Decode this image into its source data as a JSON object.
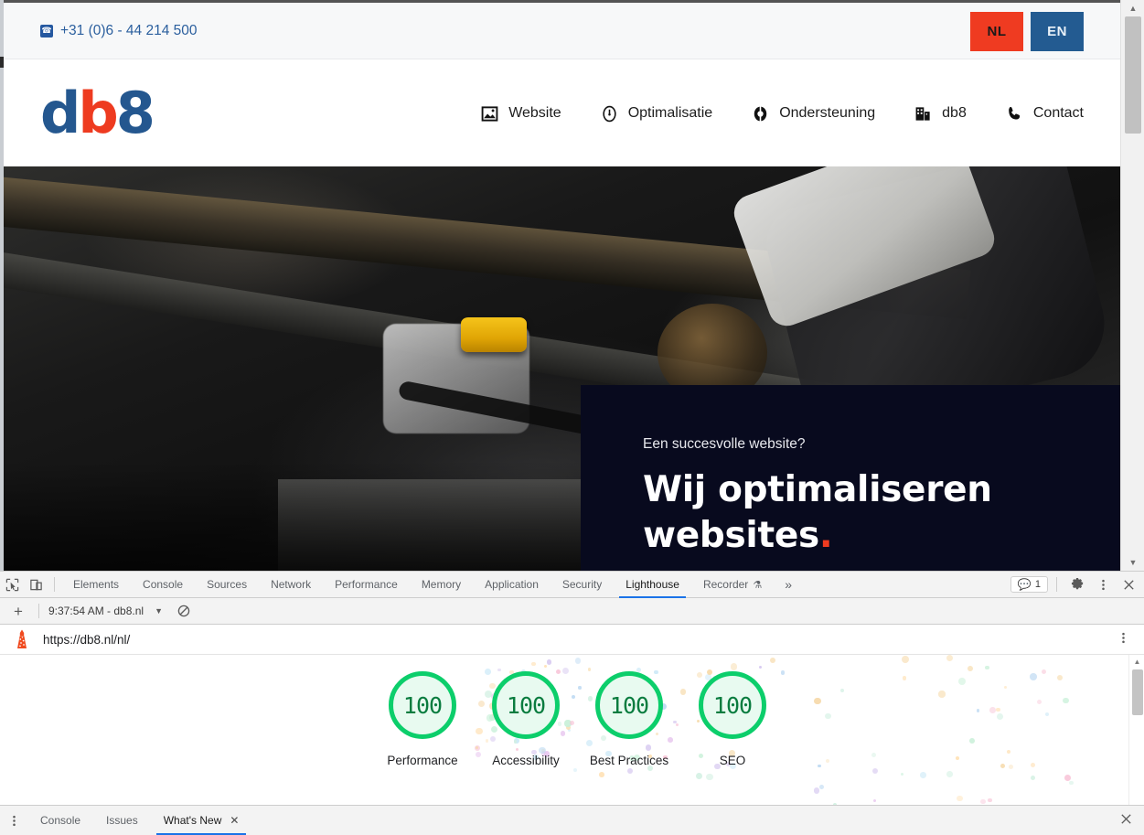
{
  "website": {
    "topbar": {
      "phone": "+31 (0)6 - 44 214 500",
      "phone_icon": "phone-icon",
      "lang_nl": "NL",
      "lang_en": "EN",
      "nl_color": "#ef3b21",
      "en_color": "#235b91"
    },
    "logo": {
      "part1": "d",
      "part2": "b",
      "part3": "8",
      "blue": "#24578f",
      "red": "#ee3b20"
    },
    "nav": [
      {
        "label": "Website",
        "icon": "image-icon"
      },
      {
        "label": "Optimalisatie",
        "icon": "gauge-icon"
      },
      {
        "label": "Ondersteuning",
        "icon": "lifebuoy-icon"
      },
      {
        "label": "db8",
        "icon": "building-icon"
      },
      {
        "label": "Contact",
        "icon": "phone-handset-icon"
      }
    ],
    "hero": {
      "eyebrow": "Een succesvolle website?",
      "title_line1": "Wij optimaliseren",
      "title_line2": "websites",
      "title_dot": ".",
      "panel_color": "#080a1e",
      "accent": "#ee3b20"
    }
  },
  "devtools": {
    "inspect_icon": "inspect-cursor-icon",
    "device_icon": "device-toolbar-icon",
    "tabs": [
      {
        "label": "Elements",
        "active": false
      },
      {
        "label": "Console",
        "active": false
      },
      {
        "label": "Sources",
        "active": false
      },
      {
        "label": "Network",
        "active": false
      },
      {
        "label": "Performance",
        "active": false
      },
      {
        "label": "Memory",
        "active": false
      },
      {
        "label": "Application",
        "active": false
      },
      {
        "label": "Security",
        "active": false
      },
      {
        "label": "Lighthouse",
        "active": true
      },
      {
        "label": "Recorder",
        "active": false,
        "suffix_icon": "flask-icon"
      }
    ],
    "more_tabs": "»",
    "messages_badge": {
      "icon": "message-icon",
      "count": "1"
    },
    "settings_icon": "gear-icon",
    "kebab_icon": "more-vertical-icon",
    "close_icon": "close-icon",
    "active_tab_underline": "#1a73e8"
  },
  "lighthouse": {
    "toolbar": {
      "new_report_icon": "plus-icon",
      "report_name": "9:37:54 AM - db8.nl",
      "dropdown_icon": "chevron-down-icon",
      "clear_icon": "clear-all-icon"
    },
    "url_row": {
      "lighthouse_icon": "lighthouse-icon",
      "url": "https://db8.nl/nl/",
      "kebab_icon": "more-vertical-icon"
    },
    "ring_color": "#0cce6b",
    "fill_color": "#e8faf0",
    "score_text_color": "#0a7c3f",
    "categories": [
      {
        "label": "Performance",
        "score": "100"
      },
      {
        "label": "Accessibility",
        "score": "100"
      },
      {
        "label": "Best Practices",
        "score": "100"
      },
      {
        "label": "SEO",
        "score": "100"
      }
    ]
  },
  "drawer": {
    "kebab_icon": "more-vertical-icon",
    "tabs": [
      {
        "label": "Console",
        "active": false,
        "closable": false
      },
      {
        "label": "Issues",
        "active": false,
        "closable": false
      },
      {
        "label": "What's New",
        "active": true,
        "closable": true
      }
    ],
    "close_icon": "close-icon"
  }
}
